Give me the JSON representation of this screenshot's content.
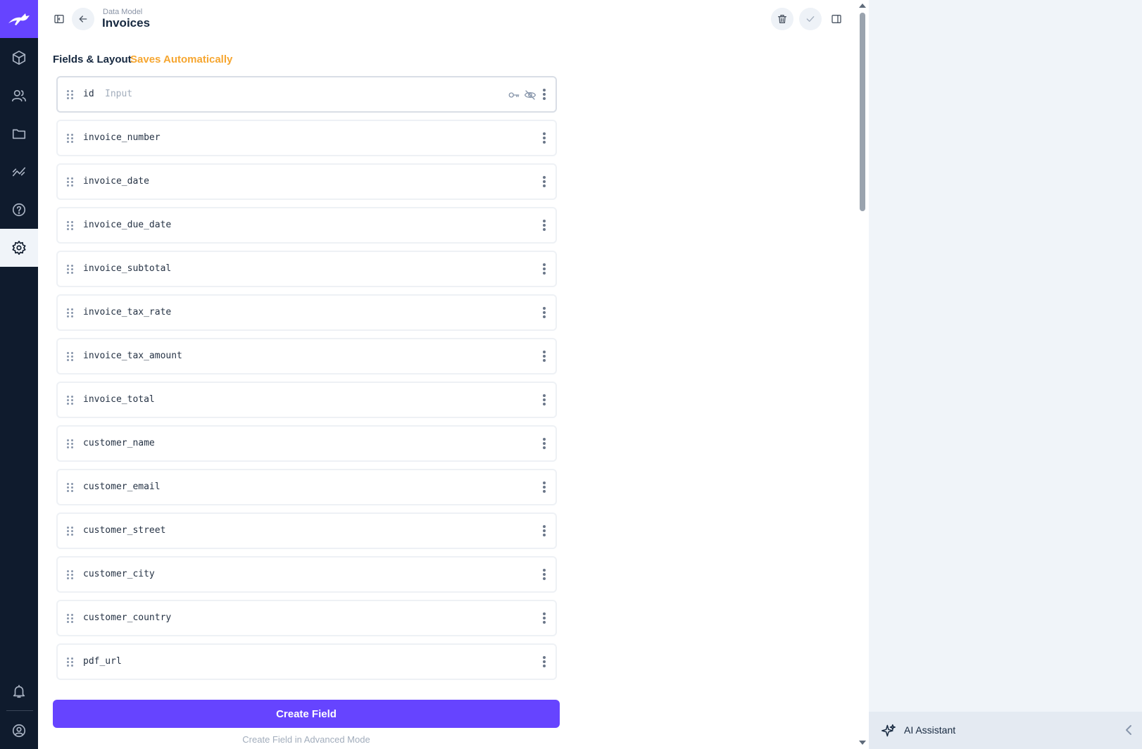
{
  "header": {
    "breadcrumb": "Data Model",
    "title": "Invoices"
  },
  "section": {
    "title": "Fields & Layout",
    "note": "Saves Automatically"
  },
  "fields": [
    {
      "name": "id",
      "type": "Input"
    },
    {
      "name": "invoice_number"
    },
    {
      "name": "invoice_date"
    },
    {
      "name": "invoice_due_date"
    },
    {
      "name": "invoice_subtotal"
    },
    {
      "name": "invoice_tax_rate"
    },
    {
      "name": "invoice_tax_amount"
    },
    {
      "name": "invoice_total"
    },
    {
      "name": "customer_name"
    },
    {
      "name": "customer_email"
    },
    {
      "name": "customer_street"
    },
    {
      "name": "customer_city"
    },
    {
      "name": "customer_country"
    },
    {
      "name": "pdf_url"
    }
  ],
  "actions": {
    "create_field": "Create Field",
    "create_field_advanced": "Create Field in Advanced Mode"
  },
  "sidebar": {
    "ai_assistant": "AI Assistant"
  },
  "colors": {
    "brand": "#6644ff",
    "nav_bg": "#0f1b2d",
    "warning": "#f6a630"
  }
}
